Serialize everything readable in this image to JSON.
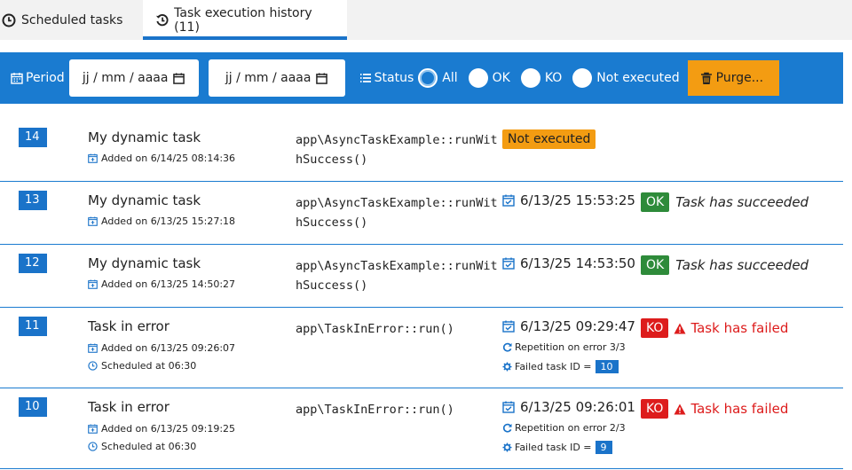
{
  "tabs": [
    {
      "label": "Scheduled tasks",
      "icon": "clock-icon",
      "active": false
    },
    {
      "label": "Task execution history (11)",
      "icon": "history-icon",
      "active": true
    }
  ],
  "filter": {
    "period_label": "Period",
    "date_from_placeholder": "jj / mm / aaaa",
    "date_to_placeholder": "jj / mm / aaaa",
    "status_label": "Status",
    "status_options": [
      "All",
      "OK",
      "KO",
      "Not executed"
    ],
    "status_selected": "All",
    "purge_label": "Purge..."
  },
  "colors": {
    "accent": "#1a7bd0",
    "ok": "#2e8b3a",
    "ko": "#dd1c1c",
    "warn": "#f39c12"
  },
  "rows": [
    {
      "id": "14",
      "name": "My dynamic task",
      "added": "Added on 6/14/25 08:14:36",
      "method": "app\\AsyncTaskExample::runWithSuccess()",
      "status": "Not executed"
    },
    {
      "id": "13",
      "name": "My dynamic task",
      "added": "Added on 6/13/25 15:27:18",
      "method": "app\\AsyncTaskExample::runWithSuccess()",
      "executed": "6/13/25 15:53:25",
      "status": "OK",
      "message": "Task has succeeded"
    },
    {
      "id": "12",
      "name": "My dynamic task",
      "added": "Added on 6/13/25 14:50:27",
      "method": "app\\AsyncTaskExample::runWithSuccess()",
      "executed": "6/13/25 14:53:50",
      "status": "OK",
      "message": "Task has succeeded"
    },
    {
      "id": "11",
      "name": "Task in error",
      "added": "Added on 6/13/25 09:26:07",
      "scheduled": "Scheduled at 06:30",
      "method": "app\\TaskInError::run()",
      "executed": "6/13/25 09:29:47",
      "repetition": "Repetition on error 3/3",
      "failed_label": "Failed task ID =",
      "failed_id": "10",
      "status": "KO",
      "message": "Task has failed"
    },
    {
      "id": "10",
      "name": "Task in error",
      "added": "Added on 6/13/25 09:19:25",
      "scheduled": "Scheduled at 06:30",
      "method": "app\\TaskInError::run()",
      "executed": "6/13/25 09:26:01",
      "repetition": "Repetition on error 2/3",
      "failed_label": "Failed task ID =",
      "failed_id": "9",
      "status": "KO",
      "message": "Task has failed"
    }
  ]
}
